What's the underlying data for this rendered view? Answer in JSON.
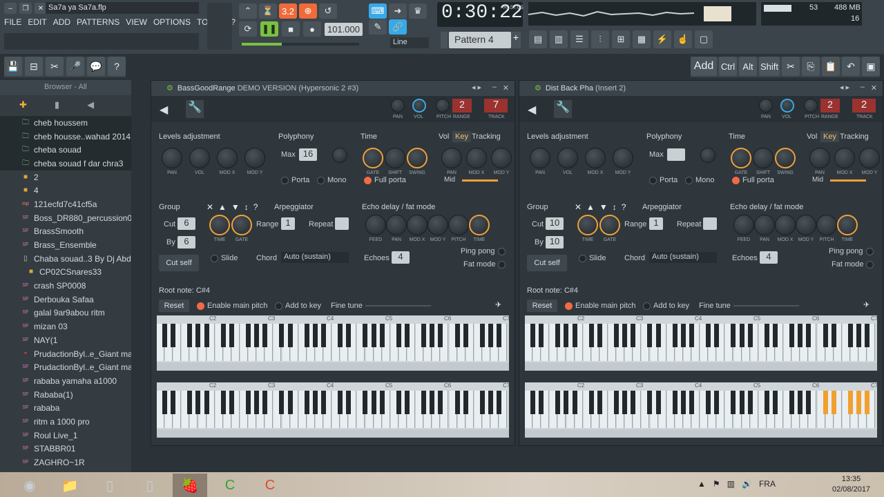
{
  "title": "Sa7a ya Sa7a.flp",
  "menu": [
    "FILE",
    "EDIT",
    "ADD",
    "PATTERNS",
    "VIEW",
    "OPTIONS",
    "TOOLS",
    "?"
  ],
  "transport": {
    "tempo": "101.000",
    "time": "0:30:22",
    "time_unit": "M:S:CS",
    "snap": "Line",
    "pattern": "Pattern 4",
    "cpu_num": "53",
    "mem": "488 MB",
    "voices": "16"
  },
  "hint_buttons": [
    "Add",
    "Ctrl",
    "Alt",
    "Shift"
  ],
  "browser": {
    "header": "Browser - All",
    "items": [
      {
        "label": "cheb houssem",
        "type": "folder",
        "sel": true
      },
      {
        "label": "cheb housse..wahad 2014",
        "type": "folder",
        "sel": true
      },
      {
        "label": "cheba souad",
        "type": "folder",
        "sel": true
      },
      {
        "label": "cheba souad f dar chra3",
        "type": "folder",
        "sel": true
      },
      {
        "label": "2",
        "type": "dir"
      },
      {
        "label": "4",
        "type": "dir"
      },
      {
        "label": "121ecfd7c41cf5a",
        "type": "mp"
      },
      {
        "label": "Boss_DR880_percussion062",
        "type": "sf"
      },
      {
        "label": "BrassSmooth",
        "type": "sf"
      },
      {
        "label": "Brass_Ensemble",
        "type": "sf"
      },
      {
        "label": "Chaba souad..3 By Dj Abdou",
        "type": "file"
      },
      {
        "label": "CP02CSnares33",
        "type": "dir",
        "indent": true
      },
      {
        "label": "crash SP0008",
        "type": "sf"
      },
      {
        "label": "Derbouka Safaa",
        "type": "sf"
      },
      {
        "label": "galal 9ar9abou ritm",
        "type": "sf"
      },
      {
        "label": "mizan 03",
        "type": "sf"
      },
      {
        "label": "NAY(1",
        "type": "sf"
      },
      {
        "label": "PrudactionByl..e_Giant male",
        "type": "lip"
      },
      {
        "label": "PrudactionByl..e_Giant male",
        "type": "sf"
      },
      {
        "label": "rababa yamaha a1000",
        "type": "sf"
      },
      {
        "label": "Rababa(1)",
        "type": "sf"
      },
      {
        "label": "rababa",
        "type": "sf"
      },
      {
        "label": "ritm a 1000 pro",
        "type": "sf"
      },
      {
        "label": "Roul Live_1",
        "type": "sf"
      },
      {
        "label": "STABBR01",
        "type": "sf"
      },
      {
        "label": "ZAGHRO~1R",
        "type": "sf"
      }
    ]
  },
  "plugins": [
    {
      "name": "BassGoodRange",
      "extra": "DEMO VERSION (Hypersonic 2 #3)",
      "pitch": "2",
      "track": "7",
      "max": "16",
      "cut": "6",
      "by": "6",
      "echoes": "4"
    },
    {
      "name": "Dist Back Pha",
      "extra": "(Insert 2)",
      "pitch": "2",
      "track": "2",
      "max": "",
      "cut": "10",
      "by": "10",
      "echoes": "4"
    }
  ],
  "labels": {
    "levels": "Levels adjustment",
    "poly": "Polyphony",
    "time": "Time",
    "vol": "Vol",
    "key": "Key",
    "tracking": "Tracking",
    "group": "Group",
    "arp": "Arpeggiator",
    "echo": "Echo delay / fat mode",
    "cut": "Cut",
    "by": "By",
    "cutself": "Cut self",
    "range": "Range",
    "repeat": "Repeat",
    "slide": "Slide",
    "chord": "Chord",
    "chord_val": "Auto (sustain)",
    "echoes": "Echoes",
    "ping": "Ping pong",
    "fat": "Fat mode",
    "root": "Root note: C#4",
    "reset": "Reset",
    "main_pitch": "Enable main pitch",
    "add_key": "Add to key",
    "fine": "Fine tune",
    "porta": "Porta",
    "mono": "Mono",
    "full_porta": "Full porta",
    "max": "Max",
    "mid": "Mid",
    "range_val": "1"
  },
  "knob_labels": {
    "levels": [
      "PAN",
      "VOL",
      "MOD X",
      "MOD Y"
    ],
    "time": [
      "GATE",
      "SHIFT",
      "SWING"
    ],
    "track": [
      "PAN",
      "MOD X",
      "MOD Y"
    ],
    "group": [
      "TIME",
      "GATE"
    ],
    "echo": [
      "FEED",
      "PAN",
      "MOD X",
      "MOD Y",
      "PITCH",
      "TIME"
    ],
    "head": [
      "PAN",
      "VOL",
      "PITCH",
      "RANGE",
      "TRACK"
    ]
  },
  "octaves": [
    "C2",
    "C3",
    "C4",
    "C5",
    "C6",
    "C7"
  ],
  "taskbar": {
    "lang": "FRA",
    "time": "13:35",
    "date": "02/08/2017"
  }
}
